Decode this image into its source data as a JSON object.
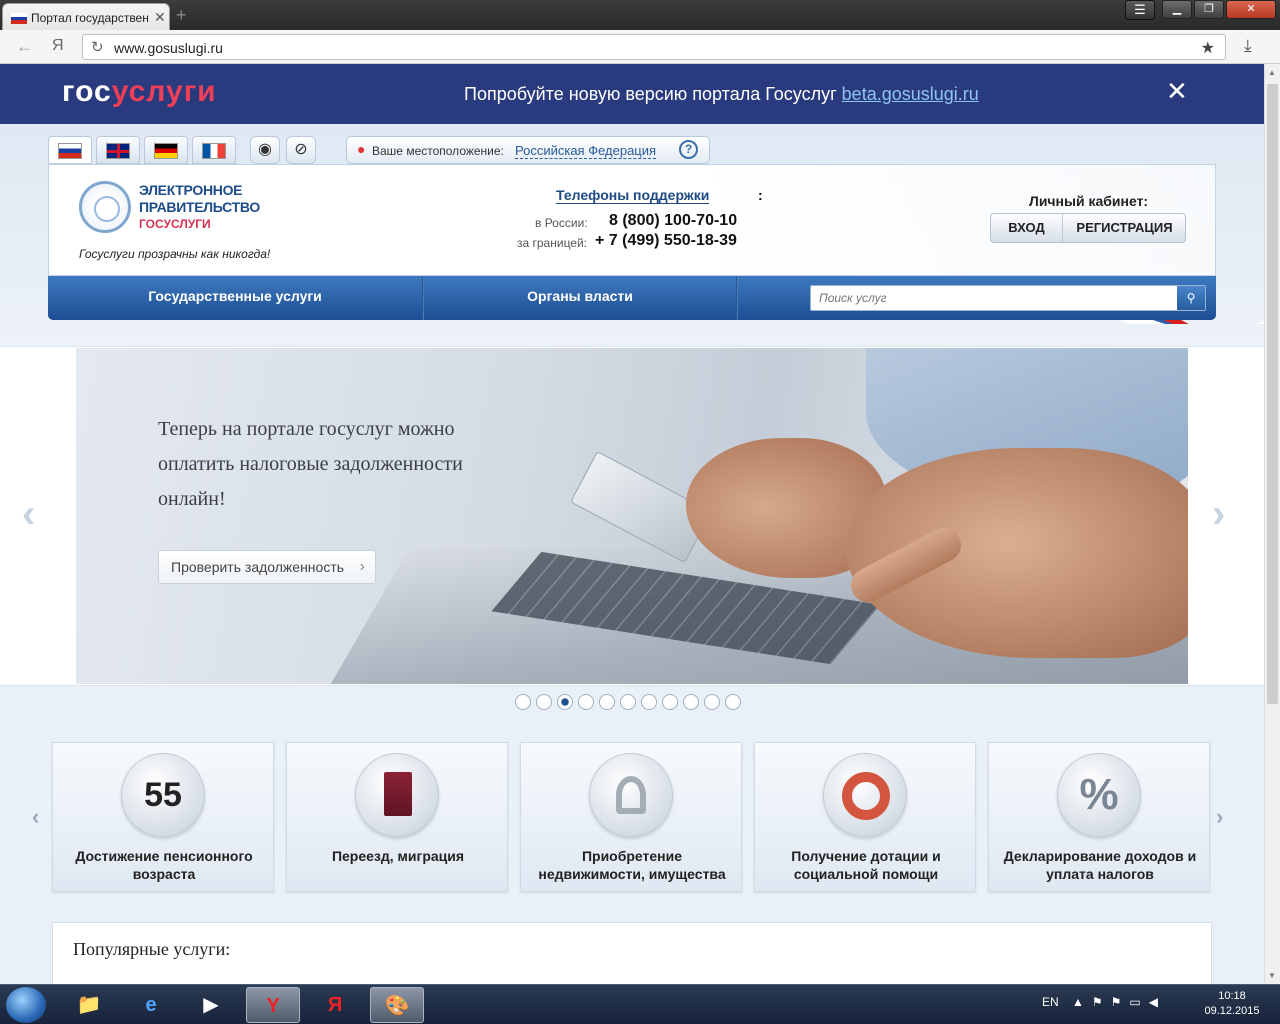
{
  "browser": {
    "tab_title": "Портал государствен",
    "url": "www.gosuslugi.ru",
    "yandex_nav": "Я"
  },
  "beta_banner": {
    "logo_white": "гос",
    "logo_red": "услуги",
    "text": "Попробуйте новую версию портала Госуслуг ",
    "link": "beta.gosuslugi.ru"
  },
  "location": {
    "label": "Ваше местоположение:",
    "value": "Российская Федерация",
    "help": "?"
  },
  "brand": {
    "line1": "ЭЛЕКТРОННОЕ",
    "line2": "ПРАВИТЕЛЬСТВО",
    "line3": "ГОСУСЛУГИ",
    "tagline": "Госуслуги прозрачны как никогда!"
  },
  "support": {
    "title": "Телефоны поддержки",
    "russia_label": "в России:",
    "russia_phone": "8 (800) 100-70-10",
    "abroad_label": "за границей:",
    "abroad_phone": "+ 7 (499) 550-18-39"
  },
  "cabinet": {
    "title": "Личный кабинет:",
    "login": "ВХОД",
    "register": "РЕГИСТРАЦИЯ"
  },
  "nav": {
    "services": "Государственные услуги",
    "authorities": "Органы власти",
    "search_placeholder": "Поиск услуг"
  },
  "slide": {
    "text": "Теперь на портале госуслуг можно оплатить налоговые задолженности онлайн!",
    "button": "Проверить задолженность",
    "total": 11,
    "active_index": 3
  },
  "categories": [
    {
      "label": "Достижение пенсионного возраста",
      "icon": "calendar-icon",
      "icon_text": "55"
    },
    {
      "label": "Переезд, миграция",
      "icon": "passport-icon"
    },
    {
      "label": "Приобретение недвижимости, имущества",
      "icon": "keys-icon"
    },
    {
      "label": "Получение дотации и социальной помощи",
      "icon": "lifebuoy-icon"
    },
    {
      "label": "Декларирование доходов и уплата налогов",
      "icon": "percent-icon",
      "icon_text": "%"
    }
  ],
  "popular": {
    "title": "Популярные услуги:"
  },
  "taskbar": {
    "lang": "EN",
    "time": "10:18",
    "date": "09.12.2015"
  },
  "colors": {
    "banner_bg": "#293b7e",
    "brand_red": "#ee3f58",
    "nav_blue": "#1d4f93"
  }
}
